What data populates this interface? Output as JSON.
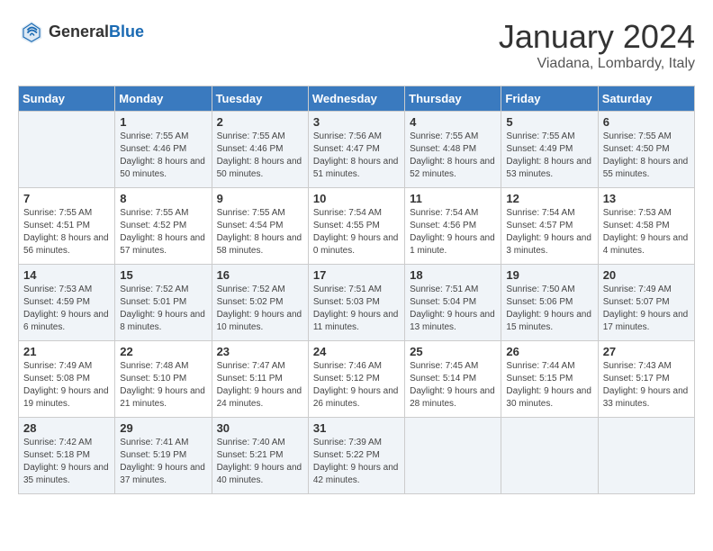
{
  "header": {
    "logo_general": "General",
    "logo_blue": "Blue",
    "month": "January 2024",
    "location": "Viadana, Lombardy, Italy"
  },
  "columns": [
    "Sunday",
    "Monday",
    "Tuesday",
    "Wednesday",
    "Thursday",
    "Friday",
    "Saturday"
  ],
  "weeks": [
    [
      {
        "day": "",
        "sunrise": "",
        "sunset": "",
        "daylight": ""
      },
      {
        "day": "1",
        "sunrise": "Sunrise: 7:55 AM",
        "sunset": "Sunset: 4:46 PM",
        "daylight": "Daylight: 8 hours and 50 minutes."
      },
      {
        "day": "2",
        "sunrise": "Sunrise: 7:55 AM",
        "sunset": "Sunset: 4:46 PM",
        "daylight": "Daylight: 8 hours and 50 minutes."
      },
      {
        "day": "3",
        "sunrise": "Sunrise: 7:56 AM",
        "sunset": "Sunset: 4:47 PM",
        "daylight": "Daylight: 8 hours and 51 minutes."
      },
      {
        "day": "4",
        "sunrise": "Sunrise: 7:55 AM",
        "sunset": "Sunset: 4:48 PM",
        "daylight": "Daylight: 8 hours and 52 minutes."
      },
      {
        "day": "5",
        "sunrise": "Sunrise: 7:55 AM",
        "sunset": "Sunset: 4:49 PM",
        "daylight": "Daylight: 8 hours and 53 minutes."
      },
      {
        "day": "6",
        "sunrise": "Sunrise: 7:55 AM",
        "sunset": "Sunset: 4:50 PM",
        "daylight": "Daylight: 8 hours and 55 minutes."
      }
    ],
    [
      {
        "day": "7",
        "sunrise": "Sunrise: 7:55 AM",
        "sunset": "Sunset: 4:51 PM",
        "daylight": "Daylight: 8 hours and 56 minutes."
      },
      {
        "day": "8",
        "sunrise": "Sunrise: 7:55 AM",
        "sunset": "Sunset: 4:52 PM",
        "daylight": "Daylight: 8 hours and 57 minutes."
      },
      {
        "day": "9",
        "sunrise": "Sunrise: 7:55 AM",
        "sunset": "Sunset: 4:54 PM",
        "daylight": "Daylight: 8 hours and 58 minutes."
      },
      {
        "day": "10",
        "sunrise": "Sunrise: 7:54 AM",
        "sunset": "Sunset: 4:55 PM",
        "daylight": "Daylight: 9 hours and 0 minutes."
      },
      {
        "day": "11",
        "sunrise": "Sunrise: 7:54 AM",
        "sunset": "Sunset: 4:56 PM",
        "daylight": "Daylight: 9 hours and 1 minute."
      },
      {
        "day": "12",
        "sunrise": "Sunrise: 7:54 AM",
        "sunset": "Sunset: 4:57 PM",
        "daylight": "Daylight: 9 hours and 3 minutes."
      },
      {
        "day": "13",
        "sunrise": "Sunrise: 7:53 AM",
        "sunset": "Sunset: 4:58 PM",
        "daylight": "Daylight: 9 hours and 4 minutes."
      }
    ],
    [
      {
        "day": "14",
        "sunrise": "Sunrise: 7:53 AM",
        "sunset": "Sunset: 4:59 PM",
        "daylight": "Daylight: 9 hours and 6 minutes."
      },
      {
        "day": "15",
        "sunrise": "Sunrise: 7:52 AM",
        "sunset": "Sunset: 5:01 PM",
        "daylight": "Daylight: 9 hours and 8 minutes."
      },
      {
        "day": "16",
        "sunrise": "Sunrise: 7:52 AM",
        "sunset": "Sunset: 5:02 PM",
        "daylight": "Daylight: 9 hours and 10 minutes."
      },
      {
        "day": "17",
        "sunrise": "Sunrise: 7:51 AM",
        "sunset": "Sunset: 5:03 PM",
        "daylight": "Daylight: 9 hours and 11 minutes."
      },
      {
        "day": "18",
        "sunrise": "Sunrise: 7:51 AM",
        "sunset": "Sunset: 5:04 PM",
        "daylight": "Daylight: 9 hours and 13 minutes."
      },
      {
        "day": "19",
        "sunrise": "Sunrise: 7:50 AM",
        "sunset": "Sunset: 5:06 PM",
        "daylight": "Daylight: 9 hours and 15 minutes."
      },
      {
        "day": "20",
        "sunrise": "Sunrise: 7:49 AM",
        "sunset": "Sunset: 5:07 PM",
        "daylight": "Daylight: 9 hours and 17 minutes."
      }
    ],
    [
      {
        "day": "21",
        "sunrise": "Sunrise: 7:49 AM",
        "sunset": "Sunset: 5:08 PM",
        "daylight": "Daylight: 9 hours and 19 minutes."
      },
      {
        "day": "22",
        "sunrise": "Sunrise: 7:48 AM",
        "sunset": "Sunset: 5:10 PM",
        "daylight": "Daylight: 9 hours and 21 minutes."
      },
      {
        "day": "23",
        "sunrise": "Sunrise: 7:47 AM",
        "sunset": "Sunset: 5:11 PM",
        "daylight": "Daylight: 9 hours and 24 minutes."
      },
      {
        "day": "24",
        "sunrise": "Sunrise: 7:46 AM",
        "sunset": "Sunset: 5:12 PM",
        "daylight": "Daylight: 9 hours and 26 minutes."
      },
      {
        "day": "25",
        "sunrise": "Sunrise: 7:45 AM",
        "sunset": "Sunset: 5:14 PM",
        "daylight": "Daylight: 9 hours and 28 minutes."
      },
      {
        "day": "26",
        "sunrise": "Sunrise: 7:44 AM",
        "sunset": "Sunset: 5:15 PM",
        "daylight": "Daylight: 9 hours and 30 minutes."
      },
      {
        "day": "27",
        "sunrise": "Sunrise: 7:43 AM",
        "sunset": "Sunset: 5:17 PM",
        "daylight": "Daylight: 9 hours and 33 minutes."
      }
    ],
    [
      {
        "day": "28",
        "sunrise": "Sunrise: 7:42 AM",
        "sunset": "Sunset: 5:18 PM",
        "daylight": "Daylight: 9 hours and 35 minutes."
      },
      {
        "day": "29",
        "sunrise": "Sunrise: 7:41 AM",
        "sunset": "Sunset: 5:19 PM",
        "daylight": "Daylight: 9 hours and 37 minutes."
      },
      {
        "day": "30",
        "sunrise": "Sunrise: 7:40 AM",
        "sunset": "Sunset: 5:21 PM",
        "daylight": "Daylight: 9 hours and 40 minutes."
      },
      {
        "day": "31",
        "sunrise": "Sunrise: 7:39 AM",
        "sunset": "Sunset: 5:22 PM",
        "daylight": "Daylight: 9 hours and 42 minutes."
      },
      {
        "day": "",
        "sunrise": "",
        "sunset": "",
        "daylight": ""
      },
      {
        "day": "",
        "sunrise": "",
        "sunset": "",
        "daylight": ""
      },
      {
        "day": "",
        "sunrise": "",
        "sunset": "",
        "daylight": ""
      }
    ]
  ]
}
